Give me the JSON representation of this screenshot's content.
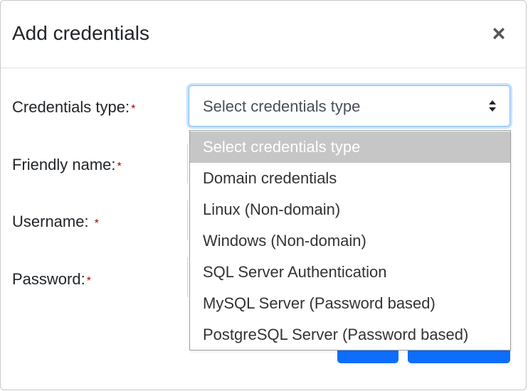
{
  "modal": {
    "title": "Add credentials",
    "close_glyph": "×",
    "fields": [
      {
        "label": "Credentials type:",
        "required_mark": "*"
      },
      {
        "label": "Friendly name:",
        "required_mark": "*"
      },
      {
        "label": "Username: ",
        "required_mark": "*"
      },
      {
        "label": "Password:",
        "required_mark": "*"
      }
    ],
    "credentials_type_select": {
      "value": "Select credentials type",
      "options": [
        "Select credentials type",
        "Domain credentials",
        "Linux (Non-domain)",
        "Windows (Non-domain)",
        "SQL Server Authentication",
        "MySQL Server (Password based)",
        "PostgreSQL Server (Password based)"
      ],
      "highlighted_index": 0
    }
  },
  "colors": {
    "primary_button": "#0d6efd",
    "required_mark": "#aa0000",
    "highlight": "#c6c6c6",
    "focus_border": "#80bdff"
  },
  "icons": {
    "close": "close-icon",
    "select_arrows": "sort-arrows-icon"
  }
}
